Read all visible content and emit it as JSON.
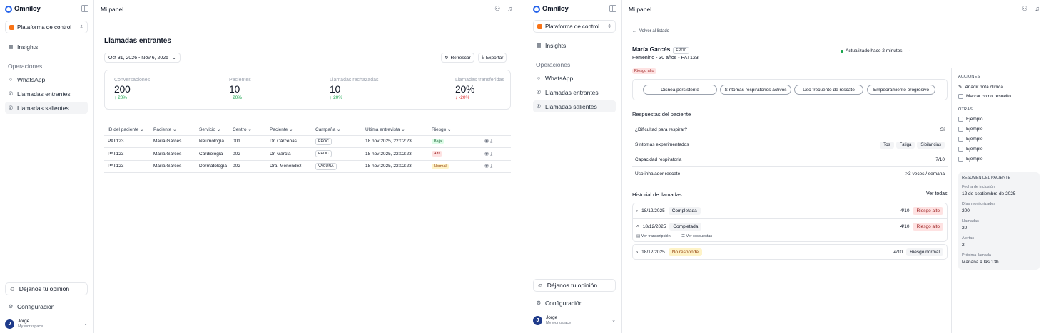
{
  "sidebar": {
    "brand": "Omniloy",
    "platform": "Plataforma de control",
    "insights": "Insights",
    "section_ops": "Operaciones",
    "whatsapp": "WhatsApp",
    "incoming": "Llamadas entrantes",
    "outgoing": "Llamadas salientes",
    "feedback": "Déjanos tu opinión",
    "settings": "Configuración",
    "user_initial": "J",
    "user_name": "Jorge",
    "workspace": "My workspace"
  },
  "topbar": {
    "title": "Mi panel"
  },
  "dashboard": {
    "title": "Llamadas entrantes",
    "date_range": "Oct 31, 2026 - Nov 6, 2025",
    "refresh": "Refrescar",
    "export": "Exportar",
    "stats": [
      {
        "label": "Conversaciones",
        "value": "200",
        "delta": "20%",
        "direction": "up"
      },
      {
        "label": "Pacientes",
        "value": "10",
        "delta": "20%",
        "direction": "up"
      },
      {
        "label": "Llamadas rechazadas",
        "value": "10",
        "delta": "20%",
        "direction": "up"
      },
      {
        "label": "Llamadas transferidas",
        "value": "20%",
        "delta": "-20%",
        "direction": "down"
      }
    ],
    "columns": [
      "ID del paciente",
      "Paciente",
      "Servicio",
      "Centro",
      "Paciente",
      "Campaña",
      "Última entrevista",
      "Riesgo"
    ],
    "rows": [
      {
        "id": "PAT123",
        "patient": "María Garcés",
        "service": "Neumología",
        "center": "001",
        "doctor": "Dr. Cárcenas",
        "campaign": "EPOC",
        "last": "18 nov 2025, 22:02:23",
        "risk": "Baja",
        "risk_class": "baja"
      },
      {
        "id": "PAT123",
        "patient": "María Garcés",
        "service": "Cardiología",
        "center": "002",
        "doctor": "Dr. García",
        "campaign": "EPOC",
        "last": "18 nov 2025, 22:02:23",
        "risk": "Alta",
        "risk_class": "alta"
      },
      {
        "id": "PAT123",
        "patient": "María Garcés",
        "service": "Dermatología",
        "center": "002",
        "doctor": "Dra. Menéndez",
        "campaign": "VACUNA",
        "last": "18 nov 2025, 22:02:23",
        "risk": "Normal",
        "risk_class": "normal"
      }
    ]
  },
  "detail": {
    "back": "Volver al listado",
    "name": "María Garcés",
    "tag": "EPOC",
    "demographics": "Femenino - 30 años - PAT123",
    "updated": "Actualizado hace 2 minutos",
    "risk_chip": "Riesgo alto",
    "symptoms": [
      "Disnea persistente",
      "Síntomas respiratorios activos",
      "Uso frecuente de rescate",
      "Empeoramiento progresivo"
    ],
    "responses_title": "Respuestas del paciente",
    "responses": [
      {
        "q": "¿Dificultad para respirar?",
        "a": "Sí",
        "chips": []
      },
      {
        "q": "Síntomas experimentados",
        "a": "",
        "chips": [
          "Tos",
          "Fatiga",
          "Sibilancias"
        ]
      },
      {
        "q": "Capacidad respiratoria",
        "a": "7/10",
        "chips": []
      },
      {
        "q": "Uso inhalador rescate",
        "a": ">3 veces / semana",
        "chips": []
      }
    ],
    "history_title": "Historial de llamadas",
    "view_all": "Ver todas",
    "calls": [
      {
        "date": "18/12/2025",
        "status": "Completada",
        "score": "4/10",
        "risk": "Riesgo alto"
      },
      {
        "date": "18/12/2025",
        "status": "Completada",
        "score": "4/10",
        "risk": "Riesgo alto"
      },
      {
        "date": "18/12/2025",
        "status": "No responde",
        "score": "4/10",
        "risk": "Riesgo normal"
      }
    ],
    "view_transcript": "Ver transcripción",
    "view_answers": "Ver respuestas",
    "actions_title": "ACCIONES",
    "add_note": "Añadir nota clínica",
    "mark_resolved": "Marcar como resuelto",
    "others_title": "OTRAS",
    "others": [
      "Ejemplo",
      "Ejemplo",
      "Ejemplo",
      "Ejemplo",
      "Ejemplo"
    ],
    "summary_title": "RESUMEN DEL PACIENTE",
    "summary": [
      {
        "label": "Fecha de inclusión",
        "value": "12 de septiembre de 2025"
      },
      {
        "label": "Días monitorizados",
        "value": "200"
      },
      {
        "label": "Llamadas",
        "value": "20"
      },
      {
        "label": "Alertas",
        "value": "2"
      },
      {
        "label": "Próxima llamada",
        "value": "Mañana a las 13h"
      }
    ]
  }
}
